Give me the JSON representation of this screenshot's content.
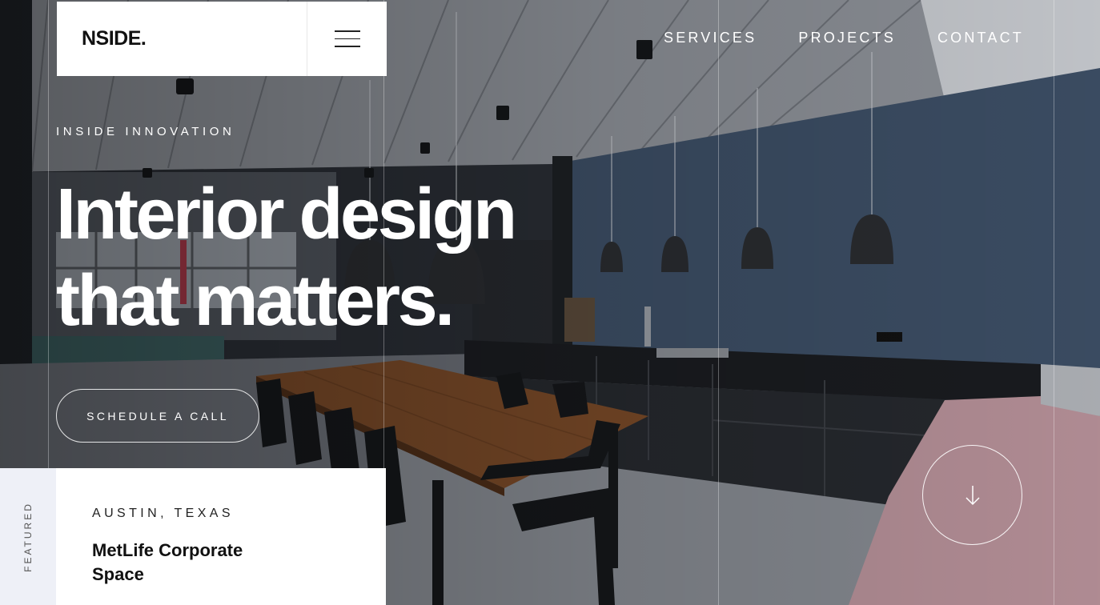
{
  "header": {
    "logo": "NSIDE.",
    "menu_icon": "hamburger-menu-icon",
    "nav": [
      {
        "label": "SERVICES"
      },
      {
        "label": "PROJECTS"
      },
      {
        "label": "CONTACT"
      }
    ]
  },
  "hero": {
    "eyebrow": "INSIDE INNOVATION",
    "headline_line1": "Interior design",
    "headline_line2": "that matters.",
    "cta_label": "SCHEDULE A CALL"
  },
  "featured": {
    "side_label": "FEATURED",
    "location": "AUSTIN, TEXAS",
    "title": "MetLife Corporate Space"
  },
  "scroll": {
    "icon": "arrow-down-icon"
  },
  "colors": {
    "wall": "#3d4f66",
    "cabinet": "#22252a",
    "table_wood": "#7a4a28",
    "bench_pink": "#b8929a",
    "white": "#ffffff"
  }
}
